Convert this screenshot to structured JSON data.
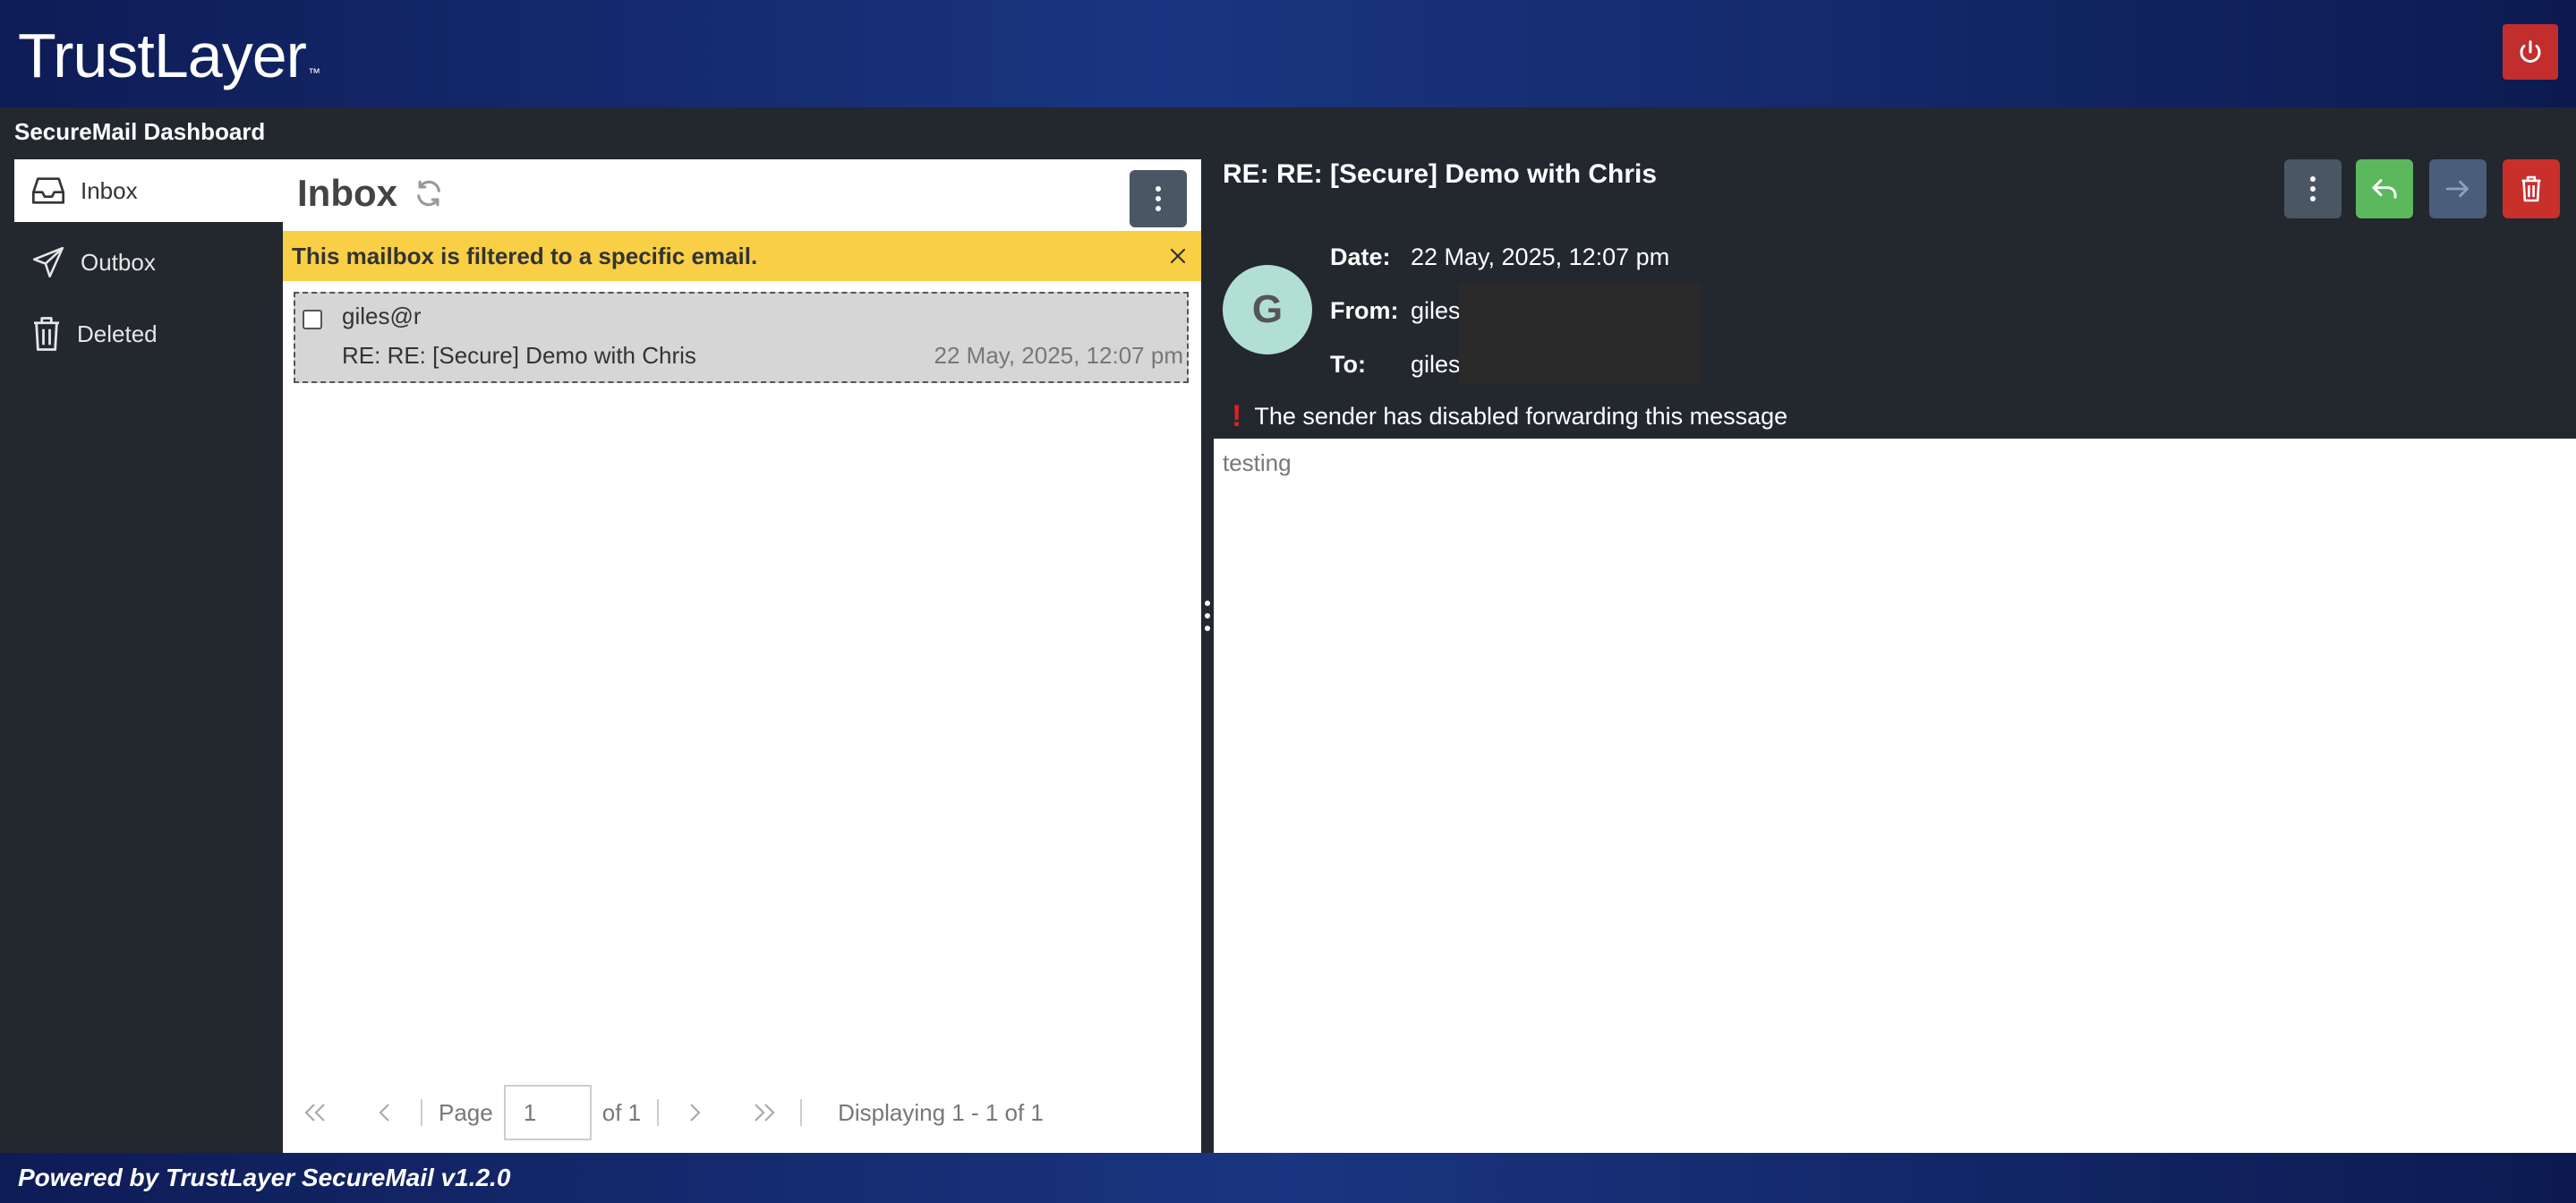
{
  "header": {
    "logo_text": "TrustLayer",
    "logo_tm": "™",
    "power_icon": "power-icon"
  },
  "subheader": {
    "title": "SecureMail Dashboard"
  },
  "sidebar": {
    "items": [
      {
        "label": "Inbox",
        "icon": "inbox-icon",
        "active": true
      },
      {
        "label": "Outbox",
        "icon": "paper-plane-icon",
        "active": false
      },
      {
        "label": "Deleted",
        "icon": "trash-icon",
        "active": false
      }
    ]
  },
  "list": {
    "title": "Inbox",
    "filter_banner": "This mailbox is filtered to a specific email.",
    "messages": [
      {
        "from": "giles@r",
        "subject": "RE: RE: [Secure] Demo with Chris",
        "date": "22 May, 2025, 12:07 pm"
      }
    ],
    "pager": {
      "page_label": "Page",
      "page_value": "1",
      "of_label": "of 1",
      "display_text": "Displaying 1 - 1 of 1"
    }
  },
  "reader": {
    "subject": "RE: RE: [Secure] Demo with Chris",
    "avatar_letter": "G",
    "date_label": "Date:",
    "date_value": "22 May, 2025, 12:07 pm",
    "from_label": "From:",
    "from_value": "giles",
    "to_label": "To:",
    "to_value": "giles",
    "warning_icon": "!",
    "warning": "The sender has disabled forwarding this message",
    "body": "testing",
    "colors": {
      "reply": "#5cb85c",
      "forward": "#4a5d7a",
      "delete": "#c9302c",
      "more": "#4a5663"
    }
  },
  "footer": {
    "text": "Powered by TrustLayer SecureMail v1.2.0"
  }
}
